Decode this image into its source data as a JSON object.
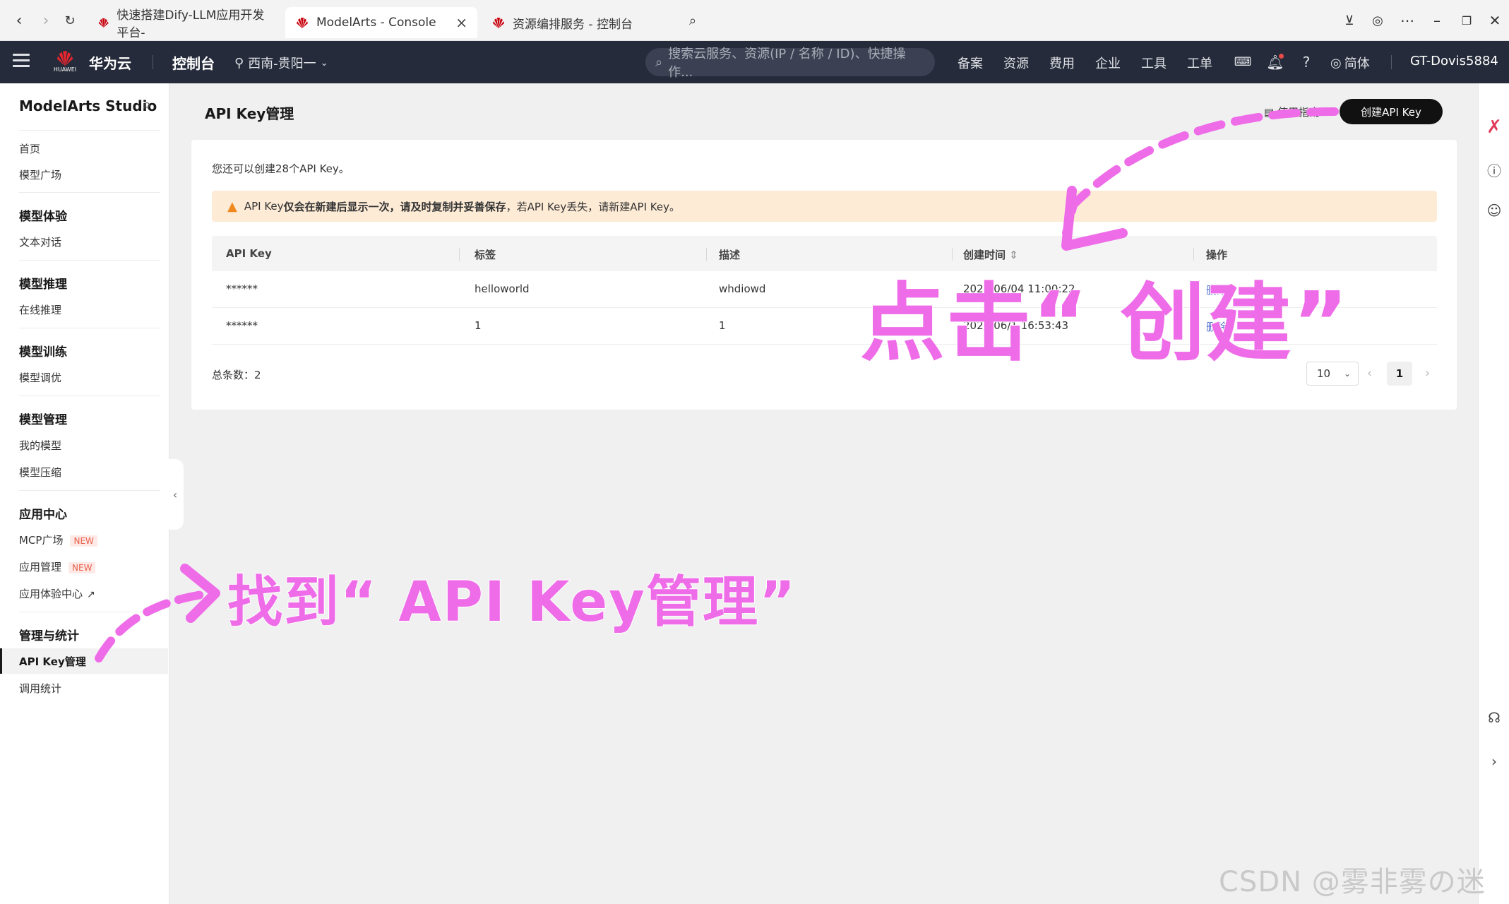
{
  "browser": {
    "tabs": [
      {
        "title": "快速搭建Dify-LLM应用开发平台-"
      },
      {
        "title": "ModelArts - Console"
      },
      {
        "title": "资源编排服务 - 控制台"
      }
    ],
    "close_icon": "×"
  },
  "header": {
    "brand_small": "HUAWEI",
    "brand": "华为云",
    "console": "控制台",
    "region": "西南-贵阳一",
    "search_placeholder": "搜索云服务、资源(IP / 名称 / ID)、快捷操作...",
    "links": [
      "备案",
      "资源",
      "费用",
      "企业",
      "工具",
      "工单"
    ],
    "lang": "简体",
    "user": "GT-Dovis5884"
  },
  "sidebar": {
    "title": "ModelArts Studio",
    "top_items": [
      "首页",
      "模型广场"
    ],
    "groups": [
      {
        "title": "模型体验",
        "items": [
          "文本对话"
        ]
      },
      {
        "title": "模型推理",
        "items": [
          "在线推理"
        ]
      },
      {
        "title": "模型训练",
        "items": [
          "模型调优"
        ]
      },
      {
        "title": "模型管理",
        "items": [
          "我的模型",
          "模型压缩"
        ]
      },
      {
        "title": "应用中心",
        "items": [
          "MCP广场",
          "应用管理",
          "应用体验中心"
        ]
      },
      {
        "title": "管理与统计",
        "items": [
          "API Key管理",
          "调用统计"
        ]
      }
    ],
    "new_badge": "NEW"
  },
  "main": {
    "title": "API Key管理",
    "guide": "使用指南",
    "create_button": "创建API Key",
    "quota": "您还可以创建28个API Key。",
    "alert_prefix": "API Key",
    "alert_bold": "仅会在新建后显示一次，请及时复制并妥善保存",
    "alert_suffix": "，若API Key丢失，请新建API Key。",
    "columns": [
      "API Key",
      "标签",
      "描述",
      "创建时间",
      "操作"
    ],
    "rows": [
      {
        "key": "******",
        "tag": "helloworld",
        "desc": "whdiowd",
        "time": "2025/06/04 11:00:22",
        "op": "删除"
      },
      {
        "key": "******",
        "tag": "1",
        "desc": "1",
        "time": "2025/06/1 16:53:43",
        "op": "删除"
      }
    ],
    "total": "总条数：2",
    "page_size": "10",
    "page": "1"
  },
  "annotations": {
    "click_create": "点击“ 创建”",
    "find_api_key": "找到“ API Key管理”"
  },
  "watermark": "CSDN @雾非雾の迷惘",
  "colors": {
    "annotation": "#ef6ce8",
    "header_bg": "#252b3a",
    "alert_bg": "#fdebd6"
  }
}
